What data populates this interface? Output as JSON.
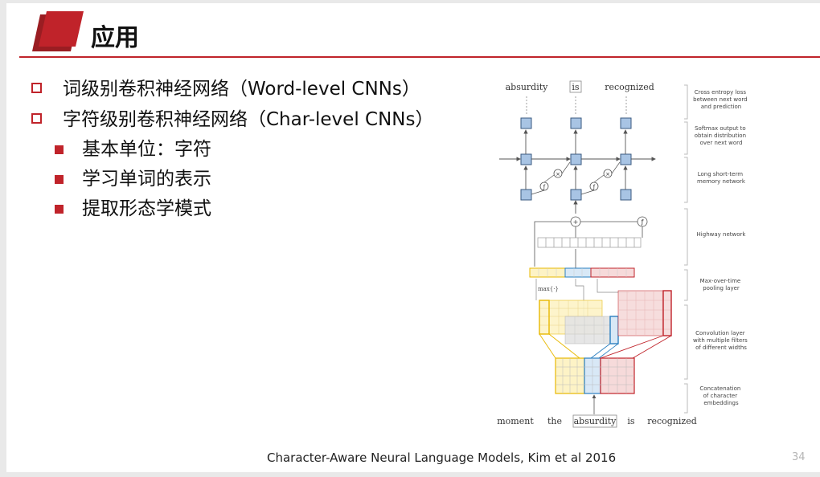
{
  "slide": {
    "title": "应用",
    "bullets": [
      {
        "text": "词级别卷积神经网络（Word-level CNNs）"
      },
      {
        "text": "字符级别卷积神经网络（Char-level CNNs）",
        "children": [
          "基本单位：字符",
          "学习单词的表示",
          "提取形态学模式"
        ]
      }
    ],
    "caption": "Character-Aware Neural Language Models, Kim et al 2016",
    "page_number": "34"
  },
  "figure": {
    "top_words": [
      "absurdity",
      "is",
      "recognized"
    ],
    "bottom_words": [
      "moment",
      "the",
      "absurdity",
      "is",
      "recognized"
    ],
    "max_label": "max{·}",
    "layer_labels": [
      [
        "Cross entropy loss",
        "between next word",
        "and prediction"
      ],
      [
        "Softmax output to",
        "obtain distribution",
        "over next word"
      ],
      [
        "Long short-term",
        "memory network"
      ],
      [
        "Highway network"
      ],
      [
        "Max-over-time",
        "pooling layer"
      ],
      [
        "Convolution layer",
        "with multiple filters",
        "of different widths"
      ],
      [
        "Concatenation",
        "of character",
        "embeddings"
      ]
    ],
    "colors": {
      "accent": "#c0232a",
      "filter_yellow": "#e8b800",
      "filter_blue": "#2a7fc0",
      "filter_red": "#c0232a",
      "lstm_cell": "#a8c4e4"
    }
  }
}
